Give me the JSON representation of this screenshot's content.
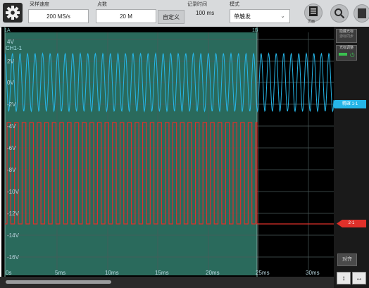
{
  "toolbar": {
    "sample_rate_label": "采样速度",
    "sample_rate_value": "200 MS/s",
    "points_label": "点数",
    "points_value": "20 M",
    "custom_button": "自定义",
    "record_time_label": "记录时间",
    "record_time_value": "100 ms",
    "mode_label": "模式",
    "mode_value": "单触发",
    "layout_button_label": "页面"
  },
  "scope": {
    "cursor_a_label": "1A",
    "cursor_b_label": "1B",
    "channel_label": "CH1-1",
    "y_labels": [
      "4V",
      "2V",
      "0V",
      "-2V",
      "-4V",
      "-6V",
      "-8V",
      "-10V",
      "-12V",
      "-14V",
      "-16V"
    ],
    "x_labels": [
      "0s",
      "5ms",
      "10ms",
      "15ms",
      "20ms",
      "25ms",
      "30ms"
    ],
    "trace_colors": {
      "blue": "#26b6e8",
      "red": "#e0302a",
      "shade": "#2a6a5c"
    }
  },
  "rightpanel": {
    "cursor_toggle_label": "隐藏光标",
    "cursor_toggle_sub": "游标同步",
    "cursor_tune_label": "光标调整",
    "blue_marker_label": "精確 1-1",
    "red_marker_label": "2-1",
    "align_label": "对齐"
  }
}
